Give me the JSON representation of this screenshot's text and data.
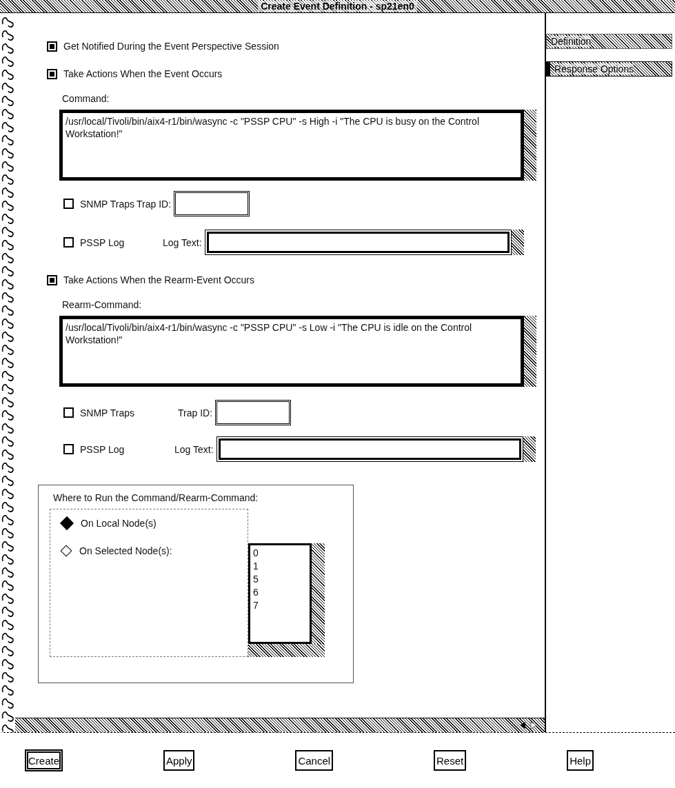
{
  "window": {
    "title": "Create Event Definition - sp21en0"
  },
  "tabs": [
    {
      "label": "Definition",
      "selected": false
    },
    {
      "label": "Response Options",
      "selected": true
    }
  ],
  "notify": {
    "label": "Get Notified During the Event Perspective Session",
    "checked": true
  },
  "sections": [
    {
      "label": "Take Actions When the Event Occurs",
      "checked": true,
      "command_label": "Command:",
      "command": "/usr/local/Tivoli/bin/aix4-r1/bin/wasync -c \"PSSP CPU\" -s High -i \"The CPU is busy on the Control Workstation!\"",
      "snmp": {
        "label": "SNMP Traps",
        "checked": false,
        "field_label": "Trap ID:"
      },
      "log": {
        "label": "PSSP Log",
        "checked": false,
        "field_label": "Log Text:"
      }
    },
    {
      "label": "Take Actions When the Rearm-Event Occurs",
      "checked": true,
      "command_label": "Rearm-Command:",
      "command": "/usr/local/Tivoli/bin/aix4-r1/bin/wasync -c \"PSSP CPU\" -s Low -i \"The CPU is idle on the Control Workstation!\"",
      "snmp": {
        "label": "SNMP Traps",
        "checked": false,
        "field_label": "Trap ID:"
      },
      "log": {
        "label": "PSSP Log",
        "checked": false,
        "field_label": "Log Text:"
      }
    }
  ],
  "where_to_run": {
    "title": "Where to Run the Command/Rearm-Command:",
    "options": [
      {
        "label": "On Local Node(s)",
        "selected": true
      },
      {
        "label": "On Selected Node(s):",
        "selected": false
      }
    ],
    "nodes": [
      "0",
      "1",
      "5",
      "6",
      "7"
    ]
  },
  "buttons": [
    {
      "label": "Create",
      "default": true
    },
    {
      "label": "Apply",
      "default": false
    },
    {
      "label": "Cancel",
      "default": false
    },
    {
      "label": "Reset",
      "default": false
    },
    {
      "label": "Help",
      "default": false
    }
  ]
}
